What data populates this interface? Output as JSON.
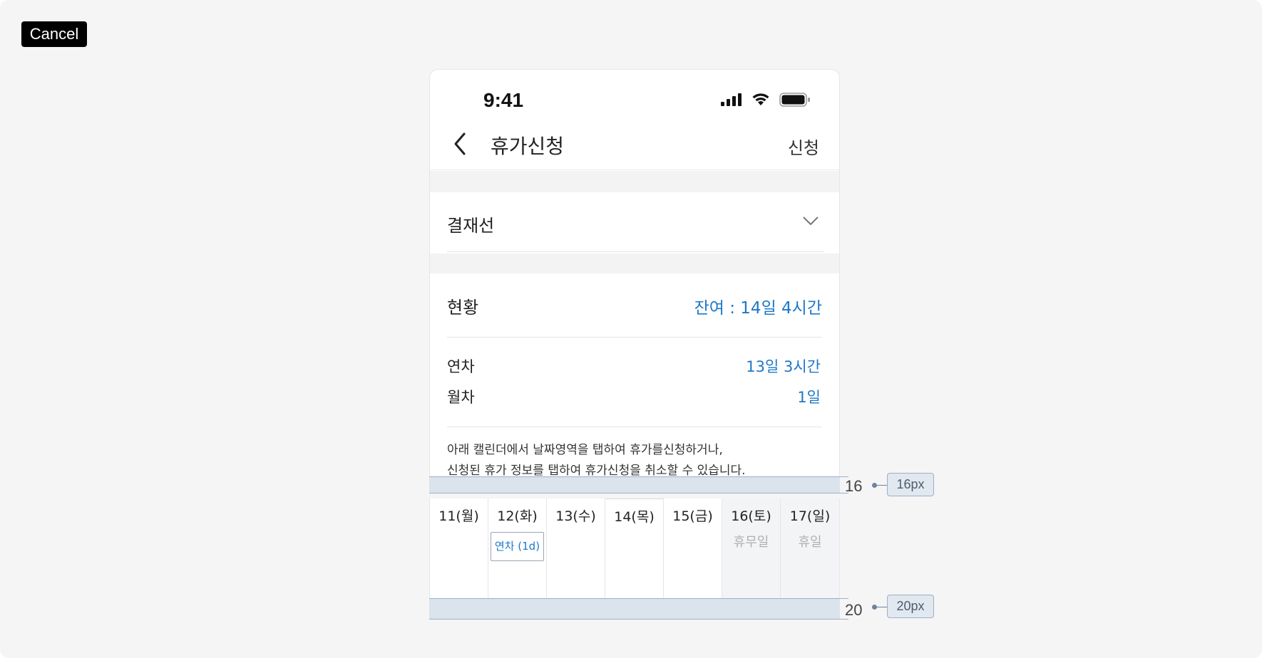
{
  "top": {
    "cancel_label": "Cancel"
  },
  "status_bar": {
    "time": "9:41"
  },
  "nav": {
    "title": "휴가신청",
    "action": "신청"
  },
  "approval": {
    "label": "결재선"
  },
  "status": {
    "label": "현황",
    "remaining": "잔여 : 14일 4시간",
    "items": [
      {
        "label": "연차",
        "value": "13일 3시간"
      },
      {
        "label": "월차",
        "value": "1일"
      }
    ]
  },
  "notice": {
    "line1": "아래 캘린더에서 날짜영역을 탭하여 휴가를신청하거나,",
    "line2": "신청된 휴가 정보를 탭하여 휴가신청을 취소할 수 있습니다."
  },
  "spacing": {
    "top": {
      "number": "16",
      "tag": "16px"
    },
    "bottom": {
      "number": "20",
      "tag": "20px"
    }
  },
  "calendar": {
    "days": [
      {
        "label": "11(월)",
        "sub": ""
      },
      {
        "label": "12(화)",
        "sub": "",
        "chip": "연차 (1d)"
      },
      {
        "label": "13(수)",
        "sub": ""
      },
      {
        "label": "14(목)",
        "sub": ""
      },
      {
        "label": "15(금)",
        "sub": ""
      },
      {
        "label": "16(토)",
        "sub": "휴무일"
      },
      {
        "label": "17(일)",
        "sub": "휴일"
      }
    ]
  },
  "colors": {
    "accent": "#1e78c8",
    "band": "#dbe3ec",
    "weekend": "#f3f4f6"
  }
}
